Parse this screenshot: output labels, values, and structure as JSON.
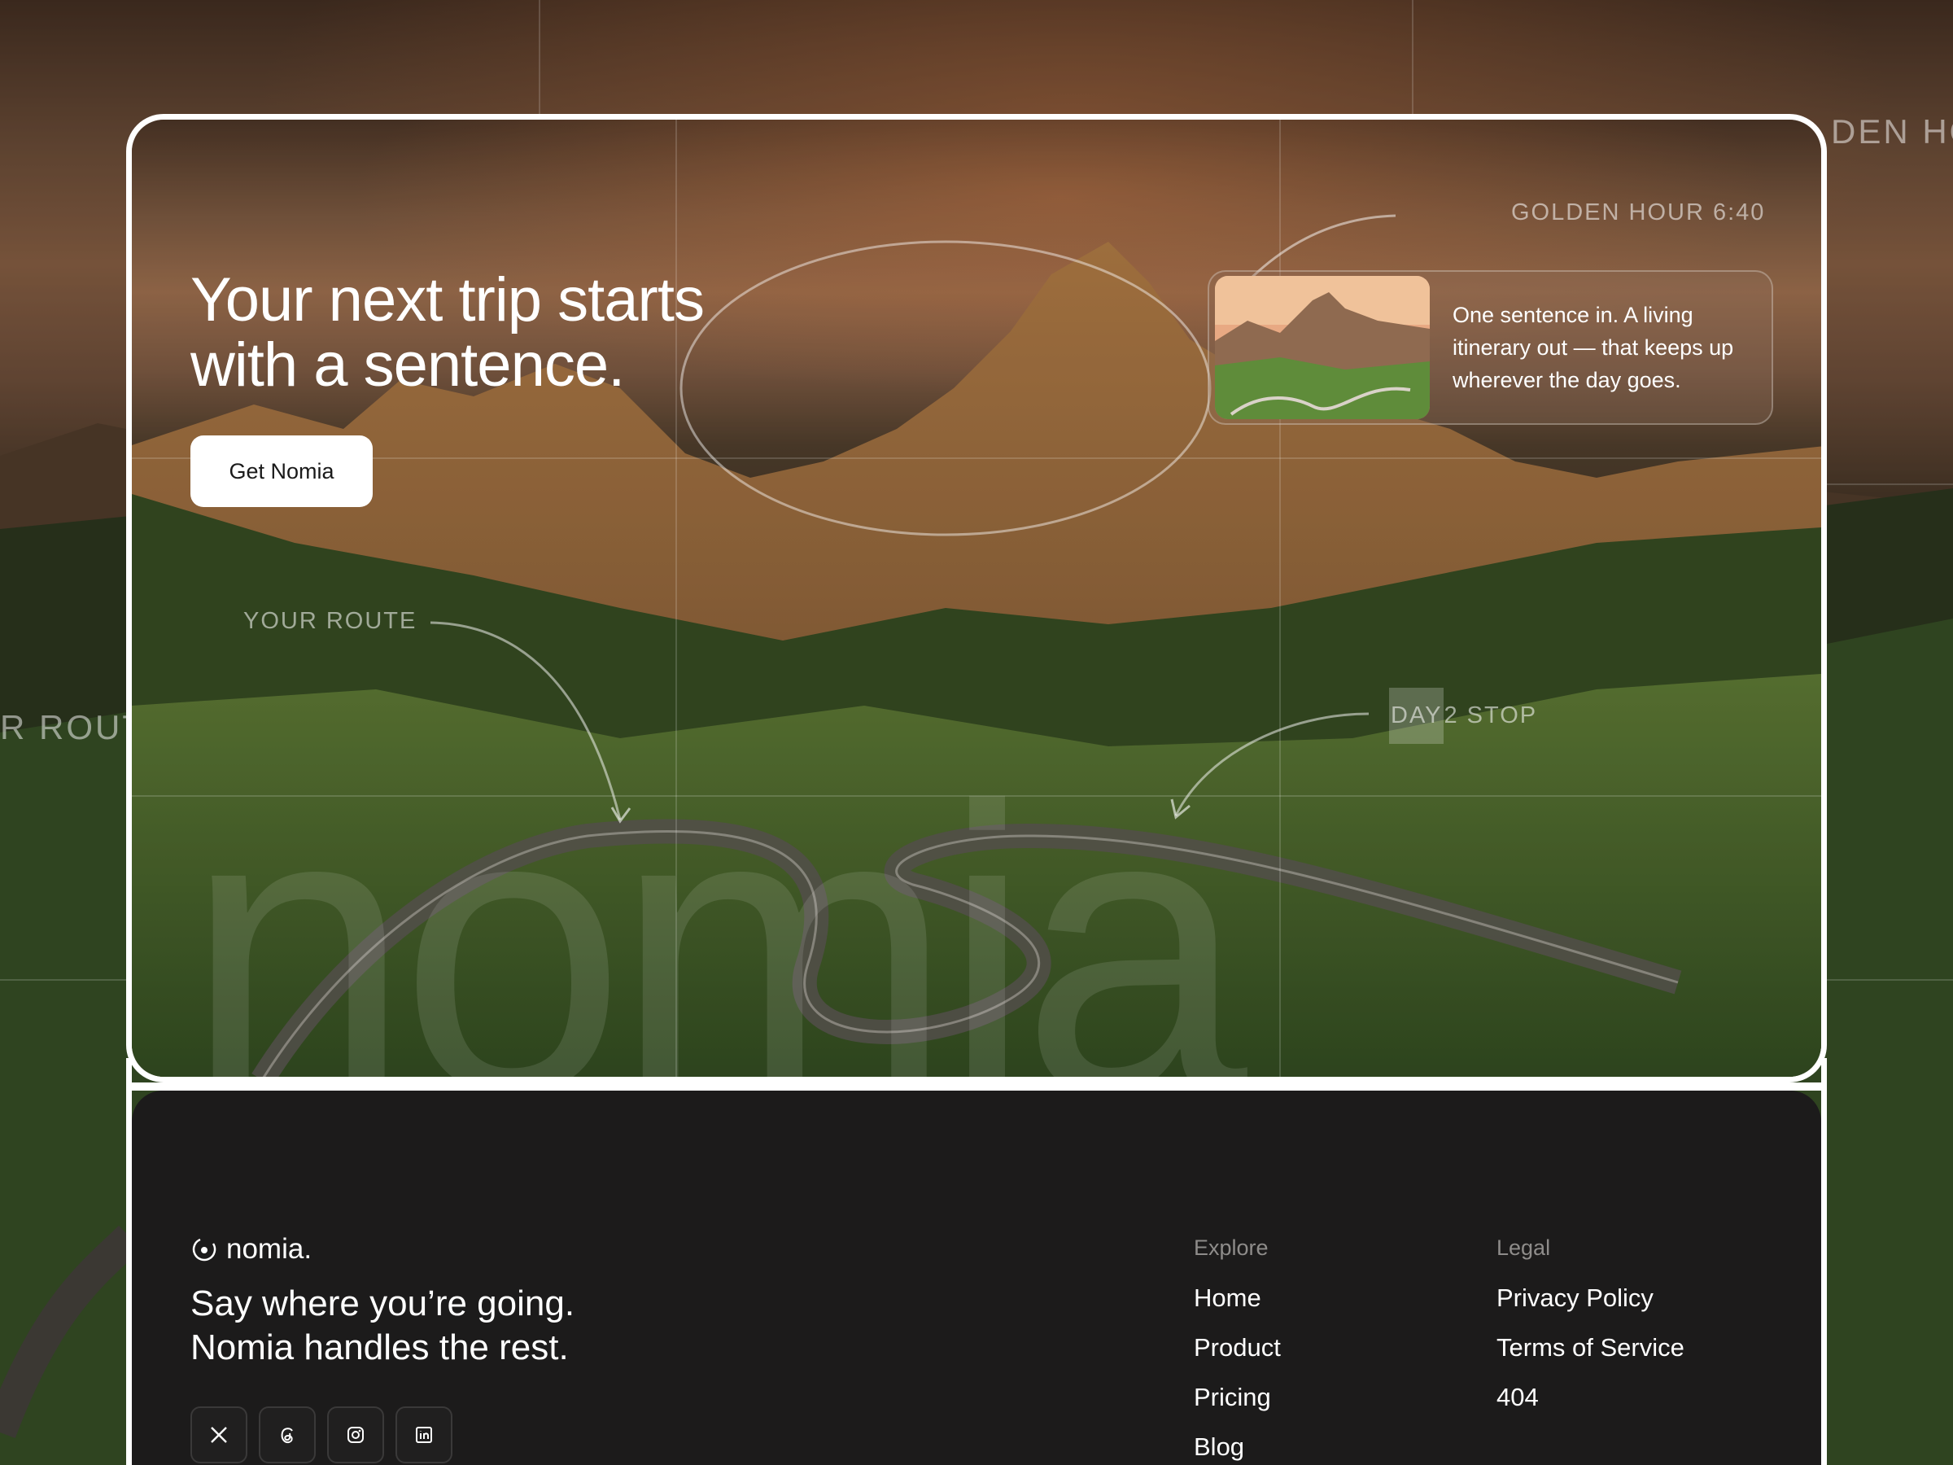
{
  "hero": {
    "title_line1": "Your next trip starts",
    "title_line2": "with a sentence.",
    "cta_label": "Get Nomia",
    "watermark": "nomia",
    "annotations": {
      "golden_hour": "GOLDEN HOUR 6:40",
      "your_route": "YOUR ROUTE",
      "day2_prefix": "DAY",
      "day2_rest": " 2 STOP"
    },
    "outer_annotations": {
      "left": "R ROUT",
      "right": "DEN HO"
    },
    "info_card": {
      "text": "One sentence in. A living itinerary out — that keeps up wherever the day goes.",
      "thumb_icon": "mountain-photo"
    }
  },
  "footer": {
    "logo_word": "nomia.",
    "logo_icon": "orbit-dot-icon",
    "tagline_line1": "Say where you’re going.",
    "tagline_line2": "Nomia handles the rest.",
    "socials": [
      "x-icon",
      "threads-icon",
      "instagram-icon",
      "linkedin-icon"
    ],
    "explore": {
      "title": "Explore",
      "links": [
        "Home",
        "Product",
        "Pricing",
        "Blog"
      ]
    },
    "legal": {
      "title": "Legal",
      "links": [
        "Privacy Policy",
        "Terms of Service",
        "404"
      ]
    }
  }
}
